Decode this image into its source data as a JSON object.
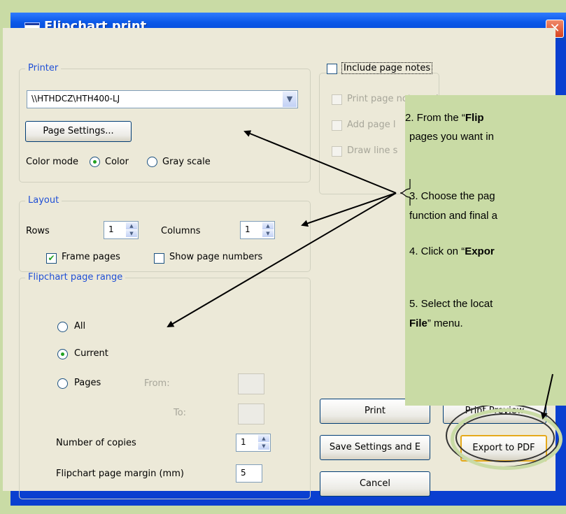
{
  "window": {
    "title": "Flipchart print",
    "close_glyph": "✕"
  },
  "printer": {
    "group_title": "Printer",
    "selected_printer": "\\\\HTHDCZ\\HTH400-LJ",
    "page_settings_label": "Page Settings...",
    "color_mode_label": "Color mode",
    "color_label": "Color",
    "grayscale_label": "Gray scale"
  },
  "notes": {
    "include_page_notes": "Include page notes",
    "print_notes_only": "Print page notes only",
    "add_page": "Add page l",
    "draw_line": "Draw line s"
  },
  "layout": {
    "group_title": "Layout",
    "rows_label": "Rows",
    "rows_value": "1",
    "columns_label": "Columns",
    "columns_value": "1",
    "frame_pages_label": "Frame pages",
    "show_page_numbers_label": "Show page numbers"
  },
  "range": {
    "group_title": "Flipchart page range",
    "all_label": "All",
    "current_label": "Current",
    "pages_label": "Pages",
    "from_label": "From:",
    "to_label": "To:",
    "copies_label": "Number of copies",
    "copies_value": "1",
    "margin_label": "Flipchart page margin (mm)",
    "margin_value": "5"
  },
  "buttons": {
    "print": "Print",
    "print_preview": "Print Preview",
    "save_settings": "Save Settings and E",
    "export_pdf": "Export to PDF",
    "cancel": "Cancel"
  },
  "instructions": {
    "step2_a": " 2.   From the “",
    "step2_b": "Flip",
    "step2_c": "pages you want in",
    "step3_a": "3.   Choose the pag",
    "step3_b": "function and final a",
    "step4_a": "4.   Click on “",
    "step4_b": "Expor",
    "step5_a": "5.   Select the locat",
    "step5_b": "File",
    "step5_c": "” menu."
  },
  "colors": {
    "background": "#c9dba5",
    "titlebar": "#0a58e8",
    "dialog_face": "#ece9d8",
    "group_title": "#1f4fd6",
    "default_button_border": "#e5a91b"
  }
}
